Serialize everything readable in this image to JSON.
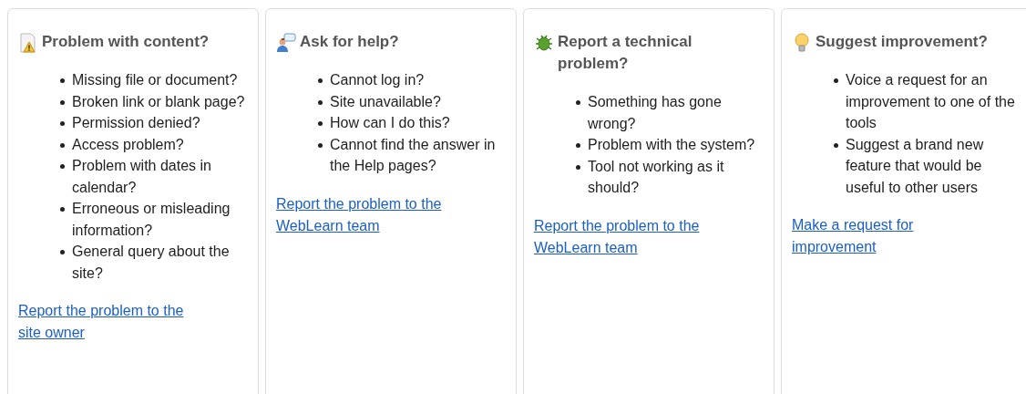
{
  "cards": [
    {
      "title": "Problem with content?",
      "items": [
        "Missing file or document?",
        "Broken link or blank page?",
        "Permission denied?",
        "Access problem?",
        "Problem with dates in calendar?",
        "Erroneous or misleading information?",
        "General query about the site?"
      ],
      "link": "Report the problem to the site owner"
    },
    {
      "title": "Ask for help?",
      "items": [
        "Cannot log in?",
        "Site unavailable?",
        "How can I do this?",
        "Cannot find the answer in the Help pages?"
      ],
      "link": "Report the problem to the WebLearn team"
    },
    {
      "title": "Report a technical problem?",
      "items": [
        "Something has gone wrong?",
        "Problem with the system?",
        "Tool not working as it should?"
      ],
      "link": "Report the problem to the WebLearn team"
    },
    {
      "title": "Suggest improvement?",
      "items": [
        "Voice a request for an improvement to one of the tools",
        "Suggest a brand new feature that would be useful to other users"
      ],
      "link": "Make a request for improvement"
    }
  ]
}
